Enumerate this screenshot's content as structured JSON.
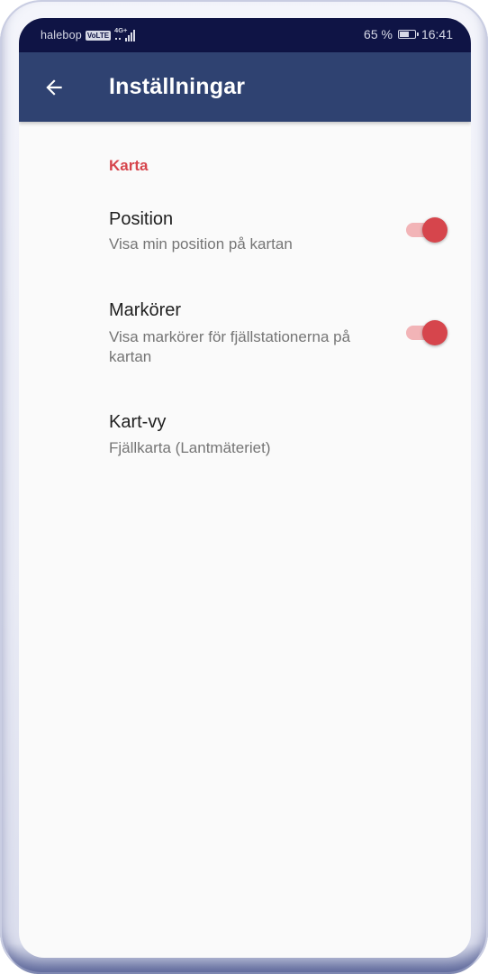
{
  "status_bar": {
    "carrier": "halebop",
    "volte": "VoLTE",
    "network": "4G+",
    "battery_percent": "65 %",
    "battery_level": 0.65,
    "time": "16:41"
  },
  "app_bar": {
    "back_icon": "arrow-back-icon",
    "title": "Inställningar"
  },
  "settings": {
    "category_title": "Karta",
    "items": [
      {
        "title": "Position",
        "summary": "Visa min position på kartan",
        "toggle": true
      },
      {
        "title": "Markörer",
        "summary": "Visa markörer för fjällstationerna på kartan",
        "toggle": true
      },
      {
        "title": "Kart-vy",
        "summary": "Fjällkarta (Lantmäteriet)"
      }
    ]
  },
  "colors": {
    "status_bar": "#0f1445",
    "app_bar": "#2f4271",
    "accent": "#d6454c",
    "background": "#fafafa"
  }
}
